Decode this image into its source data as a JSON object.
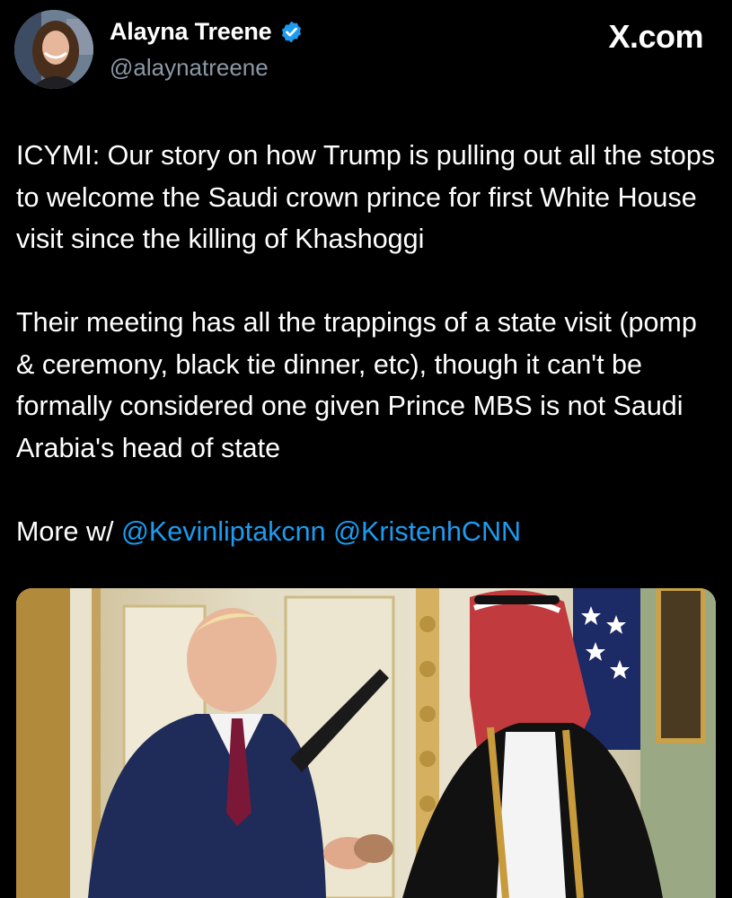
{
  "author": {
    "display_name": "Alayna Treene",
    "handle": "@alaynatreene",
    "verified": true,
    "avatar_icon": "avatar-photo-icon",
    "verified_icon": "verified-badge-icon",
    "badge_color": "#1d9bf0"
  },
  "brand": "X.com",
  "tweet": {
    "paragraph_1": "ICYMI: Our story on how Trump is pulling out all the stops to welcome the Saudi crown prince for first White House visit since the killing of Khashoggi",
    "paragraph_2": "Their meeting has all the trappings of a state visit (pomp & ceremony, black tie dinner, etc), though it can't be formally considered one given Prince MBS is not Saudi Arabia's head of state",
    "more_prefix": "More w/",
    "mentions": [
      "@Kevinliptakcnn",
      "@KristenhCNN"
    ]
  },
  "colors": {
    "background": "#000000",
    "text": "#ffffff",
    "secondary_text": "#8b98a5",
    "link": "#1d9bf0"
  }
}
